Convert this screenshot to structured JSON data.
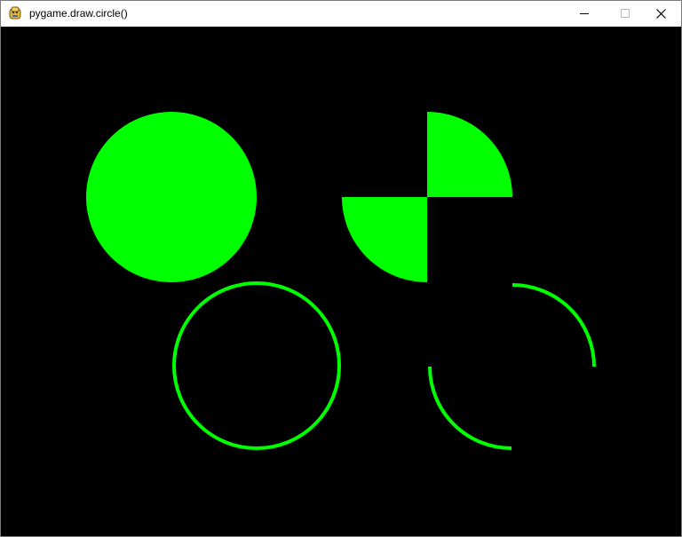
{
  "window": {
    "title": "pygame.draw.circle()",
    "icon": "pygame-snake-icon",
    "controls": [
      "minimize-icon",
      "maximize-icon",
      "close-icon"
    ]
  },
  "canvas": {
    "background": "#000000",
    "draw_color": "#00ff00",
    "shapes": [
      "filled-circle",
      "filled-quadrants-top-right-bottom-left",
      "circle-outline",
      "arc-quadrants-top-right-bottom-left"
    ]
  }
}
